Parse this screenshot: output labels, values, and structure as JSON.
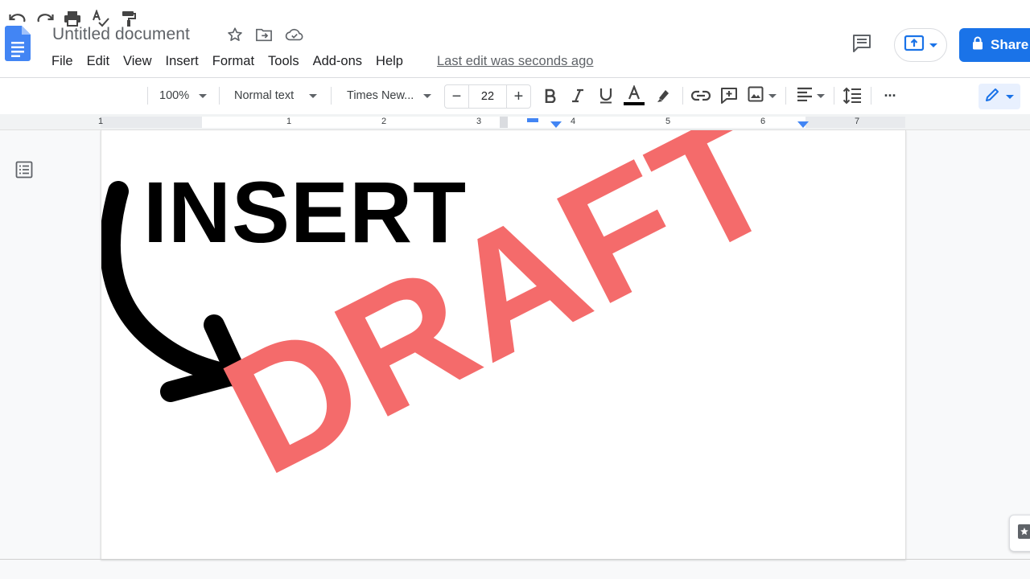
{
  "app": {
    "doc_title": "Untitled document",
    "last_edit": "Last edit was seconds ago",
    "share_label": "Share"
  },
  "menu": {
    "items": [
      "File",
      "Edit",
      "View",
      "Insert",
      "Format",
      "Tools",
      "Add-ons",
      "Help"
    ]
  },
  "toolbar": {
    "zoom": "100%",
    "style": "Normal text",
    "font": "Times New...",
    "font_size": "22",
    "minus": "−",
    "plus": "+",
    "more": "···"
  },
  "ruler": {
    "numbers": [
      "1",
      "1",
      "2",
      "3",
      "4",
      "5",
      "6",
      "7"
    ]
  },
  "document": {
    "insert_text": "INSERT",
    "draft_text": "DRAFT"
  },
  "colors": {
    "accent": "#1a73e8",
    "draft_red": "#f46b6b",
    "text_color_bar": "#000000"
  },
  "icons": [
    "docs-logo-icon",
    "star-icon",
    "move-folder-icon",
    "cloud-saved-icon",
    "comments-icon",
    "present-icon",
    "lock-icon",
    "undo-icon",
    "redo-icon",
    "print-icon",
    "spellcheck-icon",
    "paint-format-icon",
    "bold-icon",
    "italic-icon",
    "underline-icon",
    "text-color-icon",
    "highlight-icon",
    "link-icon",
    "add-comment-icon",
    "insert-image-icon",
    "align-left-icon",
    "line-spacing-icon",
    "more-icon",
    "pencil-icon",
    "outline-icon",
    "explore-icon"
  ]
}
